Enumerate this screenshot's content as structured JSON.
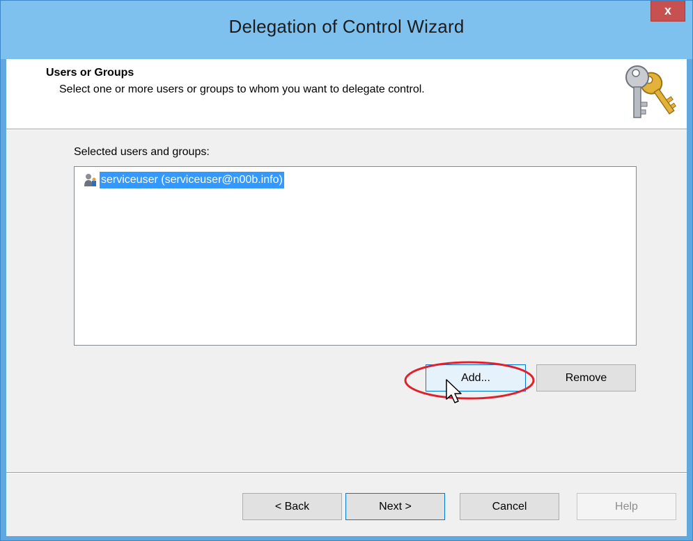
{
  "window": {
    "title": "Delegation of Control Wizard",
    "close_label": "x"
  },
  "header": {
    "title": "Users or Groups",
    "subtitle": "Select one or more users or groups to whom you want to delegate control.",
    "icon": "keys-icon"
  },
  "list": {
    "label": "Selected users and groups:",
    "items": [
      {
        "icon": "user-icon",
        "text": "serviceuser (serviceuser@n00b.info)",
        "selected": true
      }
    ]
  },
  "actions": {
    "add_label": "Add...",
    "remove_label": "Remove"
  },
  "footer": {
    "back_label": "< Back",
    "next_label": "Next >",
    "cancel_label": "Cancel",
    "help_label": "Help"
  },
  "colors": {
    "titlebar": "#7ec1ee",
    "selection": "#3399ff",
    "close": "#c75050",
    "highlight": "#e0202a"
  }
}
